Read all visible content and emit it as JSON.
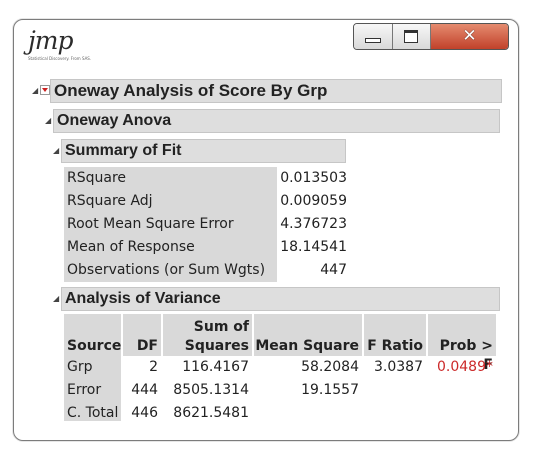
{
  "window": {
    "logo_text": "jmp",
    "logo_tagline": "Statistical Discovery. From SAS.",
    "minimize_label": "",
    "close_symbol": "✕"
  },
  "report": {
    "title": "Oneway Analysis of Score By Grp",
    "anova_title": "Oneway Anova",
    "summary_title": "Summary of Fit",
    "summary_rows": [
      {
        "label": "RSquare",
        "value": "0.013503"
      },
      {
        "label": "RSquare Adj",
        "value": "0.009059"
      },
      {
        "label": "Root Mean Square Error",
        "value": "4.376723"
      },
      {
        "label": "Mean of Response",
        "value": "18.14541"
      },
      {
        "label": "Observations (or Sum Wgts)",
        "value": "447"
      }
    ],
    "variance_title": "Analysis of Variance",
    "variance_headers": {
      "source": "Source",
      "df": "DF",
      "ss_line1": "Sum of",
      "ss_line2": "Squares",
      "ms": "Mean Square",
      "f": "F Ratio",
      "p": "Prob > F"
    },
    "variance_rows": [
      {
        "source": "Grp",
        "df": "2",
        "ss": "116.4167",
        "ms": "58.2084",
        "f": "3.0387",
        "p": "0.0489*"
      },
      {
        "source": "Error",
        "df": "444",
        "ss": "8505.1314",
        "ms": "19.1557",
        "f": "",
        "p": ""
      },
      {
        "source": "C. Total",
        "df": "446",
        "ss": "8621.5481",
        "ms": "",
        "f": "",
        "p": ""
      }
    ],
    "colors": {
      "significant": "#cc2a2a",
      "header_bg": "#dedede",
      "label_bg": "#d9d9d9"
    }
  }
}
